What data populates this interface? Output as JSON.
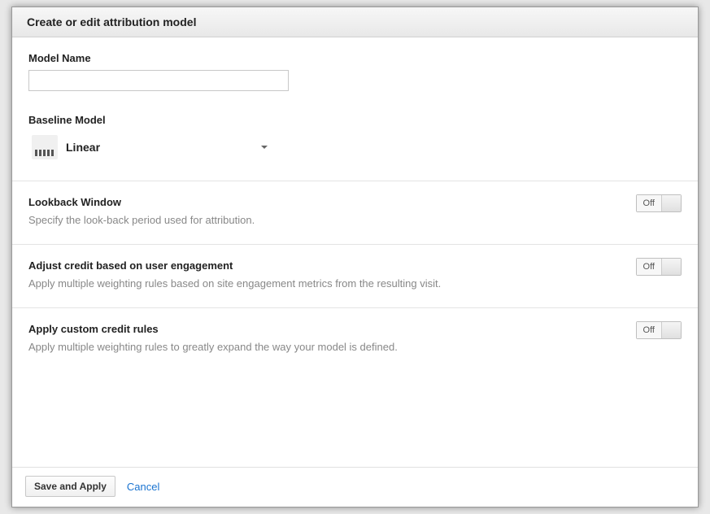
{
  "dialog": {
    "title": "Create or edit attribution model"
  },
  "fields": {
    "model_name": {
      "label": "Model Name",
      "value": ""
    },
    "baseline_model": {
      "label": "Baseline Model",
      "selected": "Linear"
    }
  },
  "options": {
    "lookback": {
      "title": "Lookback Window",
      "desc": "Specify the look-back period used for attribution.",
      "state": "Off"
    },
    "engagement": {
      "title": "Adjust credit based on user engagement",
      "desc": "Apply multiple weighting rules based on site engagement metrics from the resulting visit.",
      "state": "Off"
    },
    "custom_rules": {
      "title": "Apply custom credit rules",
      "desc": "Apply multiple weighting rules to greatly expand the way your model is defined.",
      "state": "Off"
    }
  },
  "buttons": {
    "save": "Save and Apply",
    "cancel": "Cancel"
  }
}
